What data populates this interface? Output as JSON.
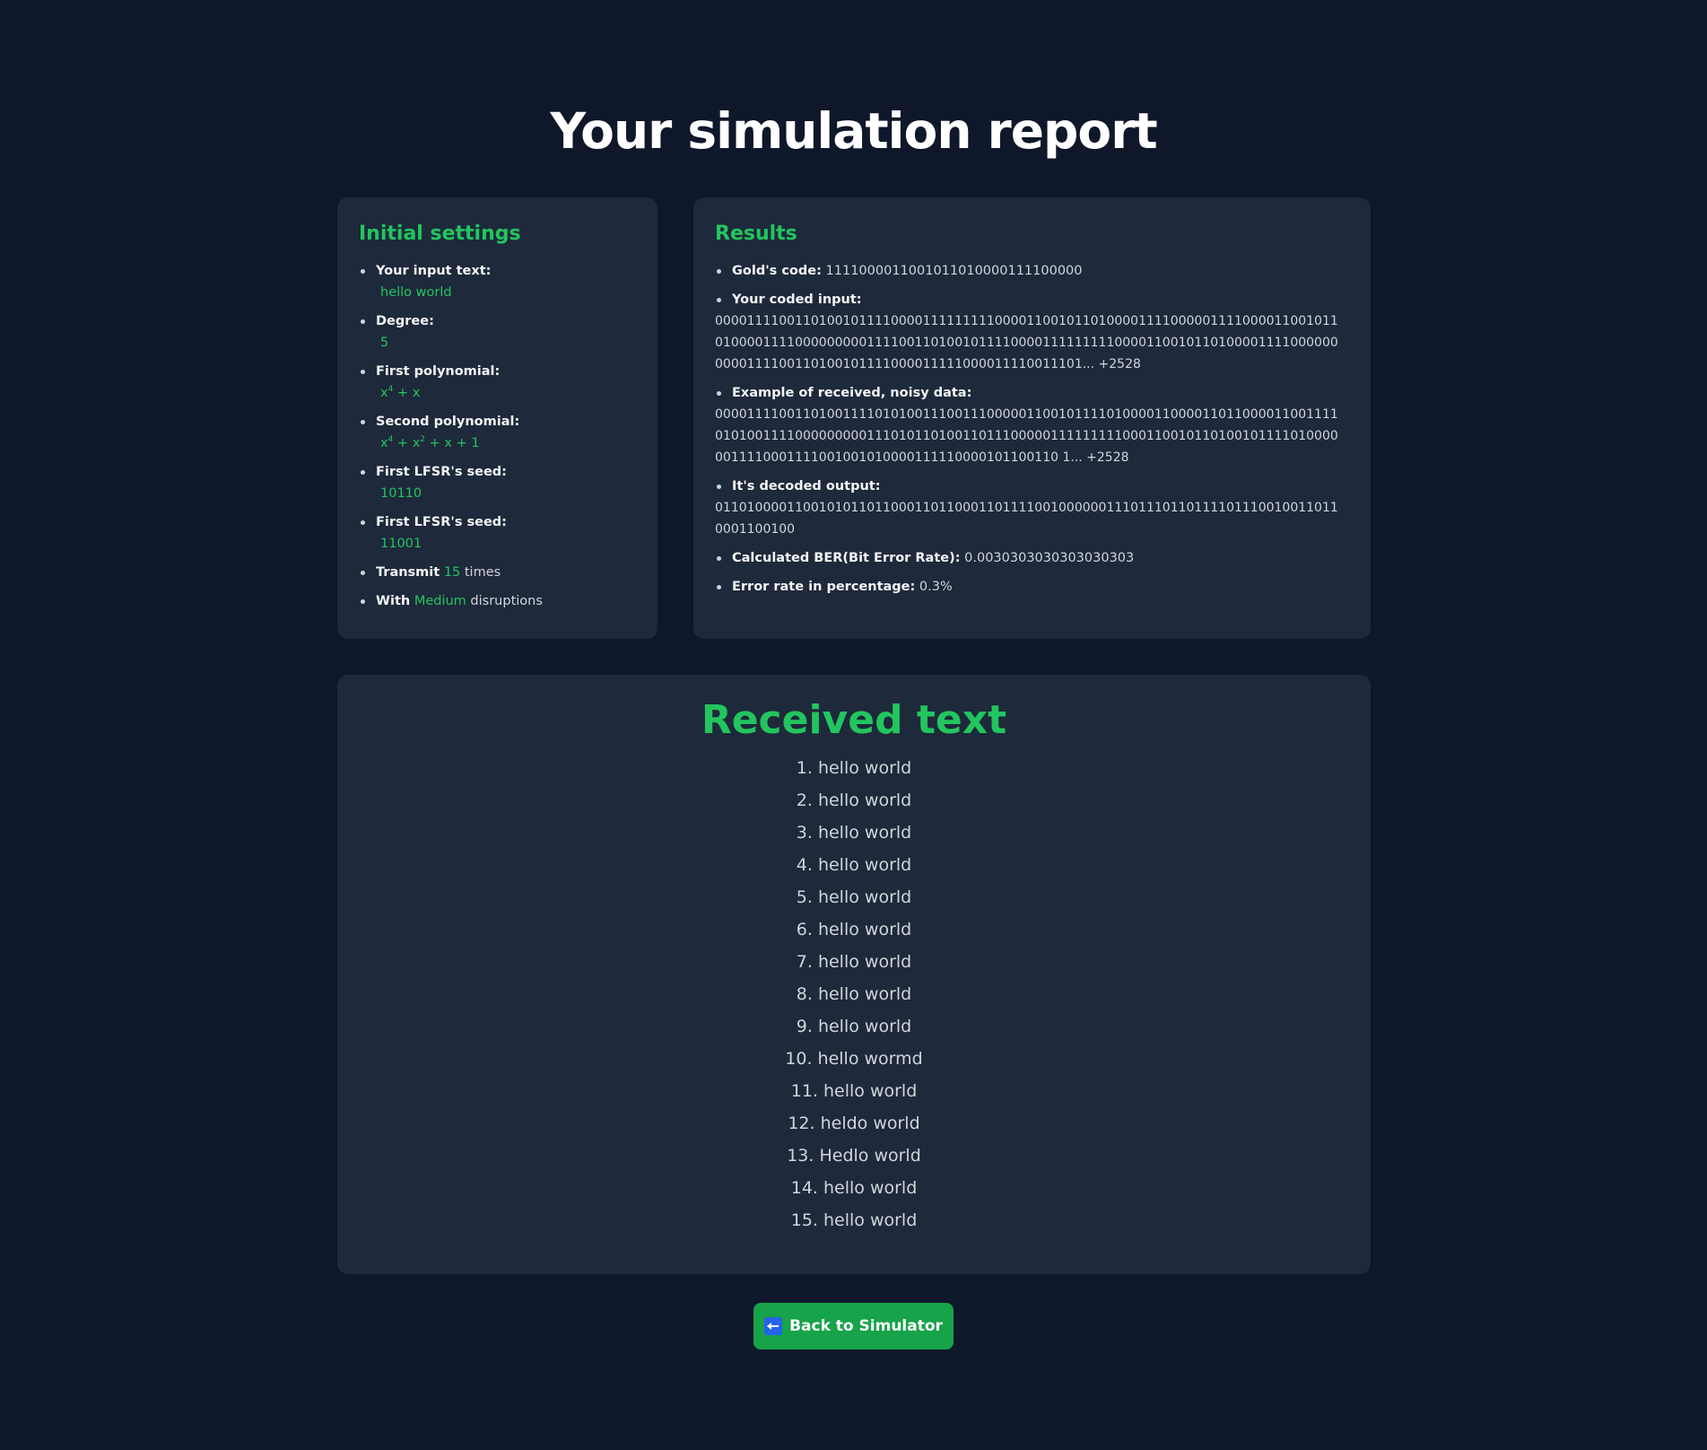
{
  "page": {
    "title": "Your simulation report"
  },
  "settings": {
    "heading": "Initial settings",
    "input_text_label": "Your input text:",
    "input_text_value": "hello world",
    "degree_label": "Degree:",
    "degree_value": "5",
    "first_poly_label": "First polynomial:",
    "first_poly_terms": [
      "x",
      "4",
      " + x"
    ],
    "second_poly_label": "Second polynomial:",
    "second_poly_terms": [
      "x",
      "4",
      " + x",
      "2",
      " + x + 1"
    ],
    "first_seed_label": "First LFSR's seed:",
    "first_seed_value": "10110",
    "second_seed_label": "First LFSR's seed:",
    "second_seed_value": "11001",
    "transmit_label": "Transmit",
    "transmit_count": "15",
    "transmit_suffix": "times",
    "disruption_label": "With",
    "disruption_level": "Medium",
    "disruption_suffix": "disruptions"
  },
  "results": {
    "heading": "Results",
    "gold_code_label": "Gold's code:",
    "gold_code_value": "1111000011001011010000111100000",
    "coded_input_label": "Your coded input:",
    "coded_input_value": "0000111100110100101111000011111111100001100101101000011110000011110000110010110100001111000000000111100110100101111000011111111100001100101101000011110000000000111100110100101111000011111000011110011101... +2528",
    "noisy_label": "Example of received, noisy data:",
    "noisy_value": "0000111100110100111101010011100111000001100101111010000110000110110000110011110101001111000000000111010110100110111000001111111110001100101101001011110100000011110001111001001010000111110000101100110 1... +2528",
    "decoded_label": "It's decoded output:",
    "decoded_value": "0110100001100101011011000110110001101111001000000111011101101111011100100110110001100100",
    "ber_label": "Calculated BER(Bit Error Rate):",
    "ber_value": "0.0030303030303030303",
    "error_pct_label": "Error rate in percentage:",
    "error_pct_value": "0.3%"
  },
  "received": {
    "heading": "Received text",
    "lines": [
      "1. hello world",
      "2. hello world",
      "3. hello world",
      "4. hello world",
      "5. hello world",
      "6. hello world",
      "7. hello world",
      "8. hello world",
      "9. hello world",
      "10. hello wormd",
      "11. hello world",
      "12. heldo world",
      "13. Hedlo world",
      "14. hello world",
      "15. hello world"
    ]
  },
  "actions": {
    "back_label": "Back to Simulator",
    "back_icon": "left-arrow-icon"
  },
  "colors": {
    "background": "#0f172a",
    "card": "#1e293b",
    "accent": "#22c55e",
    "button": "#16a34a"
  }
}
